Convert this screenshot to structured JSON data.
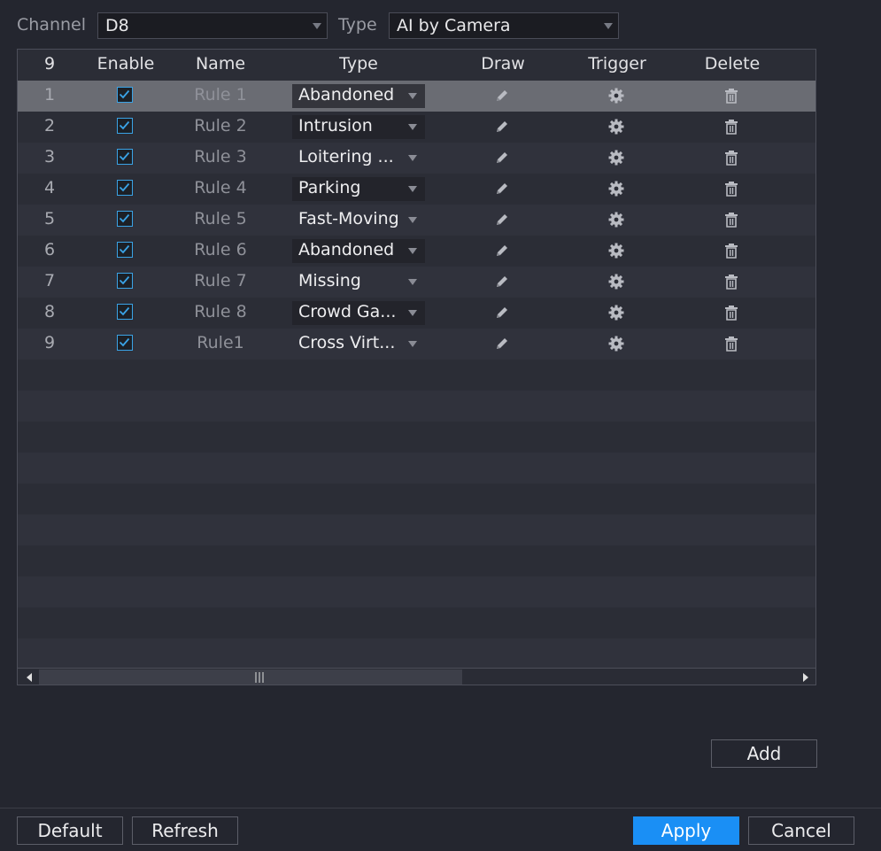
{
  "filters": {
    "channel_label": "Channel",
    "channel_value": "D8",
    "type_label": "Type",
    "type_value": "AI by Camera"
  },
  "table": {
    "headers": [
      "9",
      "Enable",
      "Name",
      "Type",
      "Draw",
      "Trigger",
      "Delete"
    ],
    "rows": [
      {
        "num": "1",
        "enabled": true,
        "name": "Rule 1",
        "type": "Abandoned"
      },
      {
        "num": "2",
        "enabled": true,
        "name": "Rule 2",
        "type": "Intrusion"
      },
      {
        "num": "3",
        "enabled": true,
        "name": "Rule 3",
        "type": "Loitering ..."
      },
      {
        "num": "4",
        "enabled": true,
        "name": "Rule 4",
        "type": "Parking"
      },
      {
        "num": "5",
        "enabled": true,
        "name": "Rule 5",
        "type": "Fast-Moving"
      },
      {
        "num": "6",
        "enabled": true,
        "name": "Rule 6",
        "type": "Abandoned"
      },
      {
        "num": "7",
        "enabled": true,
        "name": "Rule 7",
        "type": "Missing"
      },
      {
        "num": "8",
        "enabled": true,
        "name": "Rule 8",
        "type": "Crowd Ga..."
      },
      {
        "num": "9",
        "enabled": true,
        "name": "Rule1",
        "type": "Cross Virt..."
      }
    ],
    "selected_row": 0,
    "icons": {
      "draw": "pencil-icon",
      "trigger": "gear-icon",
      "delete": "trash-icon"
    },
    "scroll_fraction": 0.56
  },
  "buttons": {
    "add": "Add",
    "default": "Default",
    "refresh": "Refresh",
    "apply": "Apply",
    "cancel": "Cancel"
  },
  "colors": {
    "accent": "#1a8ff5",
    "checkbox": "#3aa3e6",
    "background": "#24262f"
  }
}
